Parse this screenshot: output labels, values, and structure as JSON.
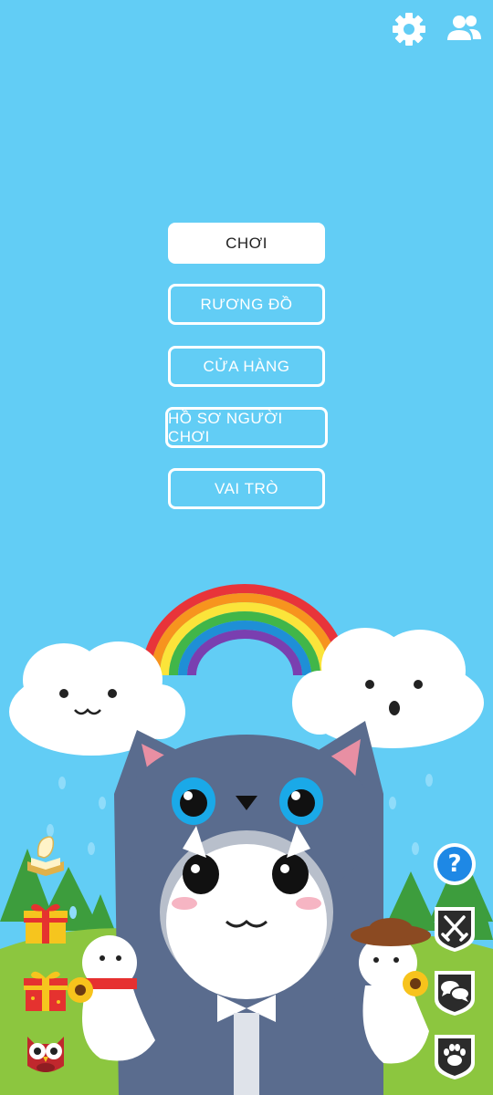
{
  "menu": {
    "play": "CHƠI",
    "chest": "RƯƠNG ĐỒ",
    "shop": "CỬA HÀNG",
    "profile": "HỒ SƠ NGƯỜI CHƠI",
    "roles": "VAI TRÒ"
  },
  "icons": {
    "top_right": [
      "gear-icon",
      "friends-icon"
    ],
    "left_side": [
      "scroll-book-icon",
      "gift-icon",
      "gift-icon",
      "owl-icon"
    ],
    "right_side": [
      "help-icon",
      "crossed-swords-icon",
      "chat-icon",
      "paw-icon"
    ],
    "help_glyph": "?"
  },
  "colors": {
    "sky": "#62cdf5",
    "button_border": "#ffffff",
    "primary_button_bg": "#ffffff",
    "help_button": "#1e88e5",
    "shield_button": "#2b2b2b"
  }
}
